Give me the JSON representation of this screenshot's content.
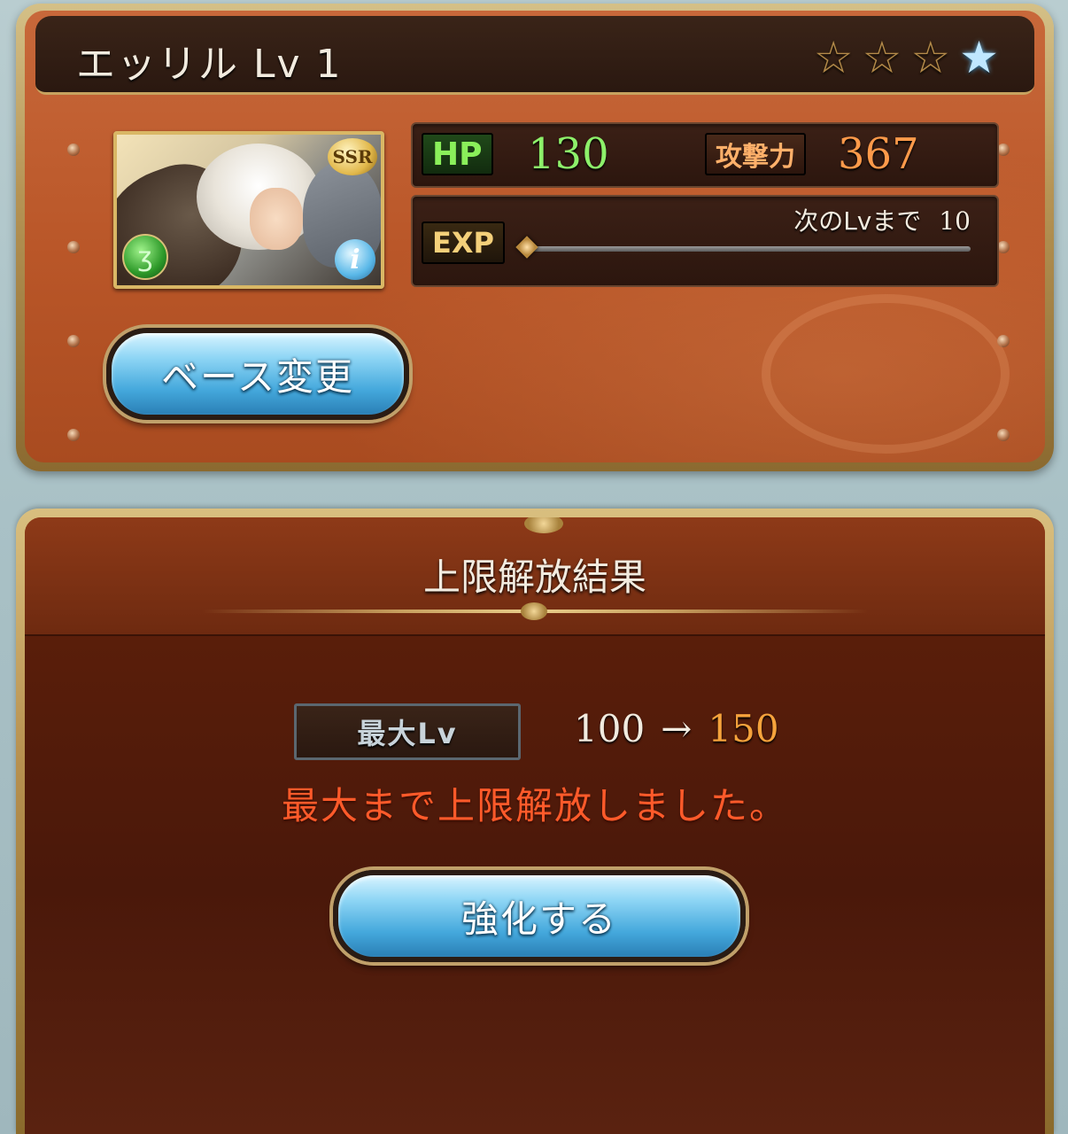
{
  "character": {
    "title": "エッリル Lv 1",
    "rarity_badge": "SSR",
    "stars": [
      "☆",
      "☆",
      "☆",
      "★"
    ],
    "hp_label": "HP",
    "hp_value": "130",
    "atk_label": "攻撃力",
    "atk_value": "367",
    "exp_label": "EXP",
    "next_lv_label": "次のLvまで",
    "next_lv_value": "10",
    "exp_progress": 0,
    "element_icon_glyph": "ʒ",
    "info_icon_glyph": "i",
    "base_change_label": "ベース変更"
  },
  "result": {
    "title": "上限解放結果",
    "max_lv_label": "最大Lv",
    "from_level": "100",
    "arrow": "→",
    "to_level": "150",
    "message": "最大まで上限解放しました。",
    "enhance_label": "強化する"
  },
  "colors": {
    "panel_bg": "#b95628",
    "gold_frame": "#c8a35f",
    "hp_text": "#8df06a",
    "atk_text": "#ff9a4a",
    "to_level": "#f6a33c",
    "message": "#ff5a2a",
    "button_blue": "#44a8dc"
  },
  "icons": {
    "element": "wind-element-icon",
    "info": "info-icon",
    "star": "star-icon"
  }
}
